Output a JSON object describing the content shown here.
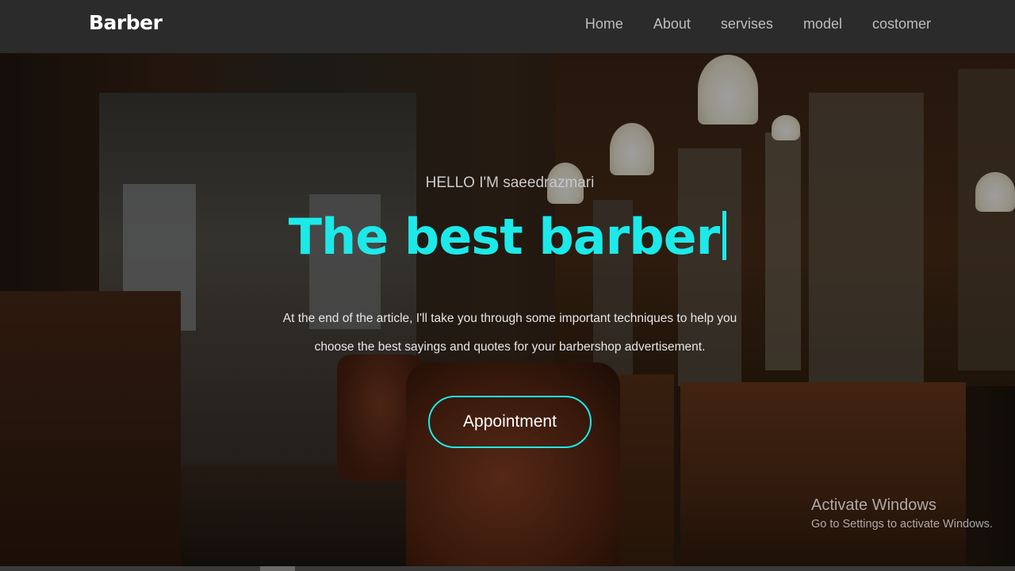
{
  "navbar": {
    "brand": "Barber",
    "links": [
      {
        "label": "Home"
      },
      {
        "label": "About"
      },
      {
        "label": "servises"
      },
      {
        "label": "model"
      },
      {
        "label": "costomer"
      }
    ],
    "background_color": "#2b2b2b"
  },
  "hero": {
    "greeting": "HELLO I'M saeedrazmari",
    "headline": "The best barber",
    "headline_color": "#1de9e9",
    "description_line1": "At the end of the article, I'll take you through some important techniques to help you",
    "description_line2": "choose the best sayings and quotes for your barbershop advertisement.",
    "appointment_button": "Appointment",
    "background_image": "barbershop-interior"
  },
  "watermark": {
    "title": "Activate Windows",
    "subtitle": "Go to Settings to activate Windows."
  }
}
